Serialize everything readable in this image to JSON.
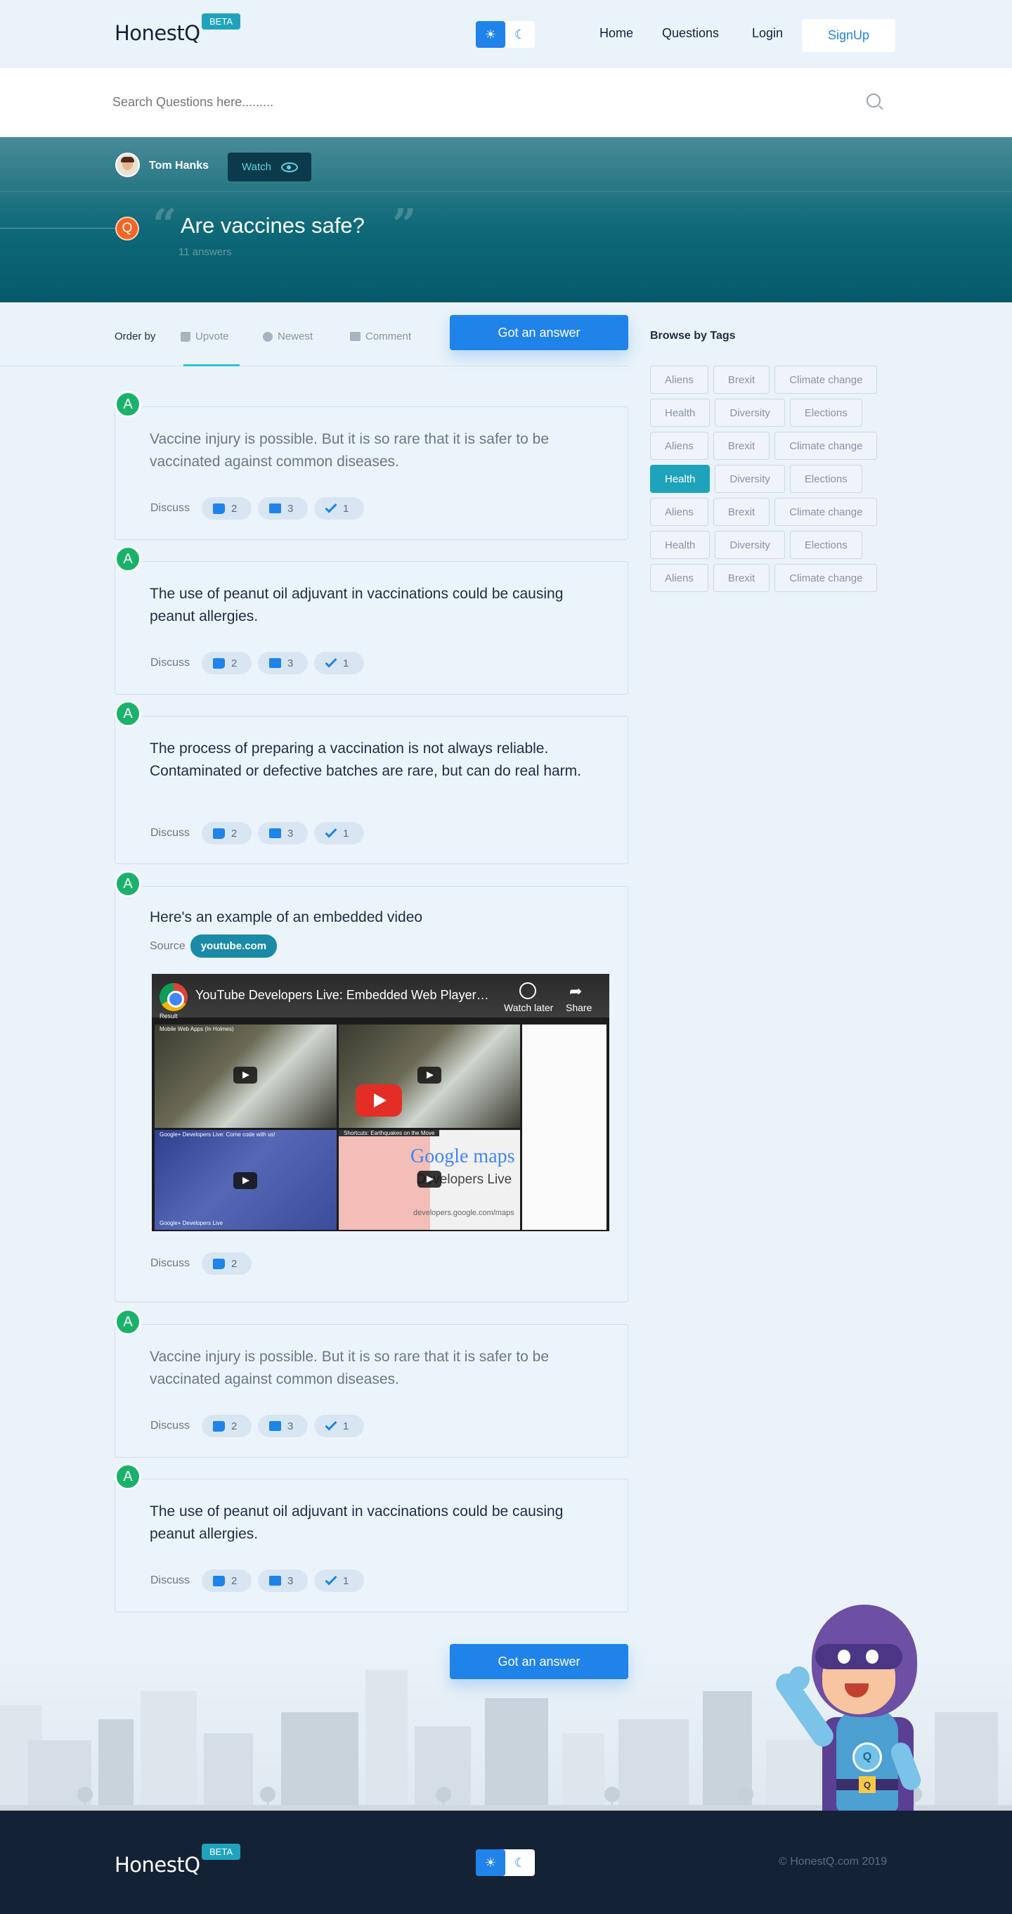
{
  "header": {
    "logo": "HonestQ",
    "beta": "BETA",
    "theme": {
      "light_icon": "sun-icon",
      "dark_icon": "moon-icon",
      "active": "light"
    },
    "nav": [
      "Home",
      "Questions",
      "Login"
    ],
    "signup": "SignUp"
  },
  "search": {
    "placeholder": "Search Questions here.........",
    "icon": "search-icon"
  },
  "question": {
    "author": "Tom Hanks",
    "watch": "Watch",
    "badge": "Q",
    "title": "Are vaccines safe?",
    "answers_count": "11 answers"
  },
  "order": {
    "label": "Order by",
    "options": [
      "Upvote",
      "Newest",
      "Comment"
    ],
    "active": "Upvote"
  },
  "cta": "Got an answer",
  "tags": {
    "title": "Browse by Tags",
    "items": [
      "Aliens",
      "Brexit",
      "Climate change",
      "Health",
      "Diversity",
      "Elections",
      "Aliens",
      "Brexit",
      "Climate change",
      "Health",
      "Diversity",
      "Elections",
      "Aliens",
      "Brexit",
      "Climate change",
      "Health",
      "Diversity",
      "Elections",
      "Aliens",
      "Brexit",
      "Climate change"
    ],
    "active_index": 9
  },
  "answers": [
    {
      "badge": "A",
      "text": "Vaccine injury is possible. But it is so rare that it is safer to be vaccinated against common diseases.",
      "discuss": "Discuss",
      "upvotes": "2",
      "comments": "3",
      "agrees": "1"
    },
    {
      "badge": "A",
      "text": "The use of peanut oil adjuvant in vaccinations could be causing peanut allergies.",
      "discuss": "Discuss",
      "upvotes": "2",
      "comments": "3",
      "agrees": "1"
    },
    {
      "badge": "A",
      "text": "The process of preparing a vaccination is not always reliable. Contaminated or defective batches are rare, but can do real harm.",
      "discuss": "Discuss",
      "upvotes": "2",
      "comments": "3",
      "agrees": "1"
    },
    {
      "badge": "A",
      "text": "Here's an example of an embedded video",
      "source_label": "Source",
      "source": "youtube.com",
      "discuss": "Discuss",
      "upvotes": "2",
      "video": {
        "title": "YouTube Developers Live: Embedded Web Player Cu...",
        "watch_later": "Watch later",
        "share": "Share",
        "result": "Result",
        "tiles": [
          "Mobile Web Apps (In Holmes)",
          "Google+ Developers Live: Come code with us!",
          "Shortcuts: Earthquakes on the Move",
          "Google+ Developers Live"
        ],
        "maps_brand": "Google maps",
        "maps_sub": "Developers Live",
        "maps_url": "developers.google.com/maps"
      }
    },
    {
      "badge": "A",
      "text": "Vaccine injury is possible. But it is so rare that it is safer to be vaccinated against common diseases.",
      "discuss": "Discuss",
      "upvotes": "2",
      "comments": "3",
      "agrees": "1"
    },
    {
      "badge": "A",
      "text": "The use of peanut oil adjuvant in vaccinations could be causing peanut allergies.",
      "discuss": "Discuss",
      "upvotes": "2",
      "comments": "3",
      "agrees": "1"
    }
  ],
  "footer": {
    "logo": "HonestQ",
    "beta": "BETA",
    "copyright": "© HonestQ.com 2019"
  },
  "colors": {
    "accent": "#1f83e9",
    "teal": "#1fa3bd",
    "answer_badge": "#1ab26b",
    "question_badge": "#f26522",
    "footer_bg": "#142236"
  }
}
